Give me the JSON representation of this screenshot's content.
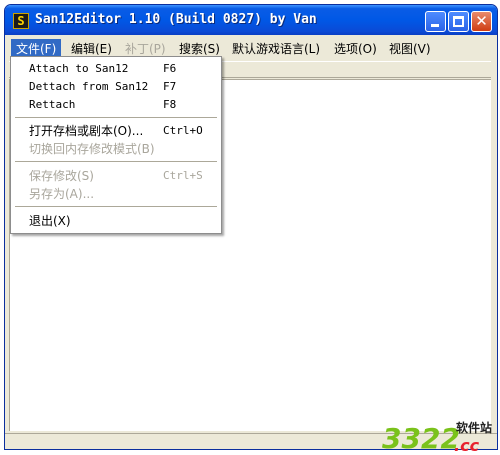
{
  "window": {
    "title": "San12Editor 1.10 (Build 0827) by Van",
    "app_icon_glyph": "S",
    "close_glyph": "✕"
  },
  "menubar": {
    "items": [
      {
        "label": "文件(F)",
        "state": "active"
      },
      {
        "label": "编辑(E)",
        "state": "normal"
      },
      {
        "label": "补丁(P)",
        "state": "disabled"
      },
      {
        "label": "搜索(S)",
        "state": "normal"
      },
      {
        "label": "默认游戏语言(L)",
        "state": "normal"
      },
      {
        "label": "选项(O)",
        "state": "normal"
      },
      {
        "label": "视图(V)",
        "state": "normal"
      }
    ]
  },
  "file_menu": {
    "attach": {
      "label": "Attach to San12",
      "accel": "F6"
    },
    "dettach": {
      "label": "Dettach from San12",
      "accel": "F7"
    },
    "rettach": {
      "label": "Rettach",
      "accel": "F8"
    },
    "open": {
      "label": "打开存档或剧本(O)...",
      "accel": "Ctrl+O"
    },
    "switch_mode": {
      "label": "切换回内存修改模式(B)",
      "accel": ""
    },
    "save": {
      "label": "保存修改(S)",
      "accel": "Ctrl+S"
    },
    "save_as": {
      "label": "另存为(A)...",
      "accel": ""
    },
    "exit": {
      "label": "退出(X)",
      "accel": ""
    }
  },
  "watermark": {
    "number": "3322",
    "cc": ".cc",
    "site": "软件站"
  },
  "colors": {
    "title_blue": "#0058e6",
    "menu_highlight": "#316ac5",
    "disabled_text": "#a9a69c",
    "window_face": "#ece9d8"
  }
}
